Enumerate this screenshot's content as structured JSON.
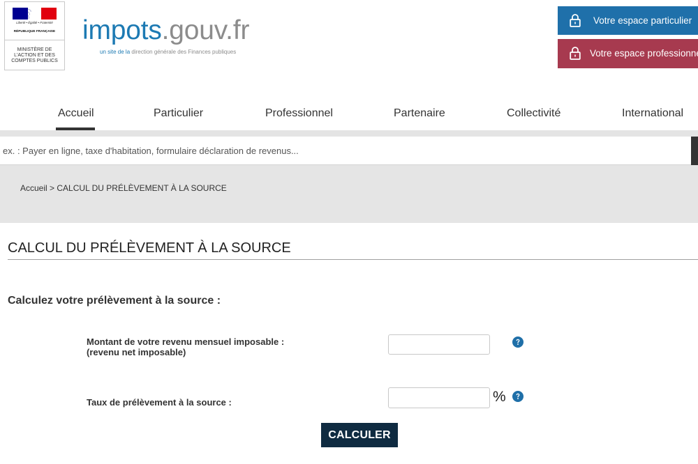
{
  "header": {
    "republic_logo": {
      "motto": "Liberté • Égalité • Fraternité",
      "name": "RÉPUBLIQUE FRANÇAISE",
      "ministry_lines": [
        "MINISTÈRE DE",
        "L'ACTION ET DES",
        "COMPTES PUBLICS"
      ],
      "flag_colors": {
        "blue": "#000091",
        "white": "#ffffff",
        "red": "#e1000f"
      }
    },
    "site_logo": {
      "name_part1": "impots",
      "name_part2": ".gouv.fr",
      "tagline_part1": "un site de la",
      "tagline_part2": "direction générale des Finances publiques",
      "color_primary": "#1d7ab3",
      "color_secondary": "#8c8c8c"
    },
    "account_buttons": [
      {
        "label": "Votre espace particulier",
        "icon": "lock-icon",
        "color": "#1f70aa"
      },
      {
        "label": "Votre espace professionne",
        "icon": "lock-icon",
        "color": "#a73a4f"
      }
    ]
  },
  "nav": {
    "items": [
      {
        "label": "Accueil",
        "active": true
      },
      {
        "label": "Particulier",
        "active": false
      },
      {
        "label": "Professionnel",
        "active": false
      },
      {
        "label": "Partenaire",
        "active": false
      },
      {
        "label": "Collectivité",
        "active": false
      },
      {
        "label": "International",
        "active": false
      }
    ],
    "active_indicator_color": "#333333"
  },
  "search": {
    "placeholder": "ex. : Payer en ligne, taxe d'habitation, formulaire déclaration de revenus...",
    "value": ""
  },
  "breadcrumb": {
    "home": "Accueil",
    "separator": ">",
    "current": "CALCUL DU PRÉLÈVEMENT À LA SOURCE"
  },
  "page": {
    "title": "CALCUL DU PRÉLÈVEMENT À LA SOURCE",
    "subtitle": "Calculez votre prélèvement à la source :",
    "form": {
      "fields": [
        {
          "label": "Montant de votre revenu mensuel imposable :",
          "sublabel": "(revenu net imposable)",
          "value": "",
          "help_icon": "help-icon"
        },
        {
          "label": "Taux de prélèvement à la source :",
          "value": "",
          "unit": "%",
          "help_icon": "help-icon"
        }
      ],
      "submit_label": "CALCULER",
      "submit_color": "#0f2b41",
      "help_icon_color": "#1f6fa8"
    }
  }
}
